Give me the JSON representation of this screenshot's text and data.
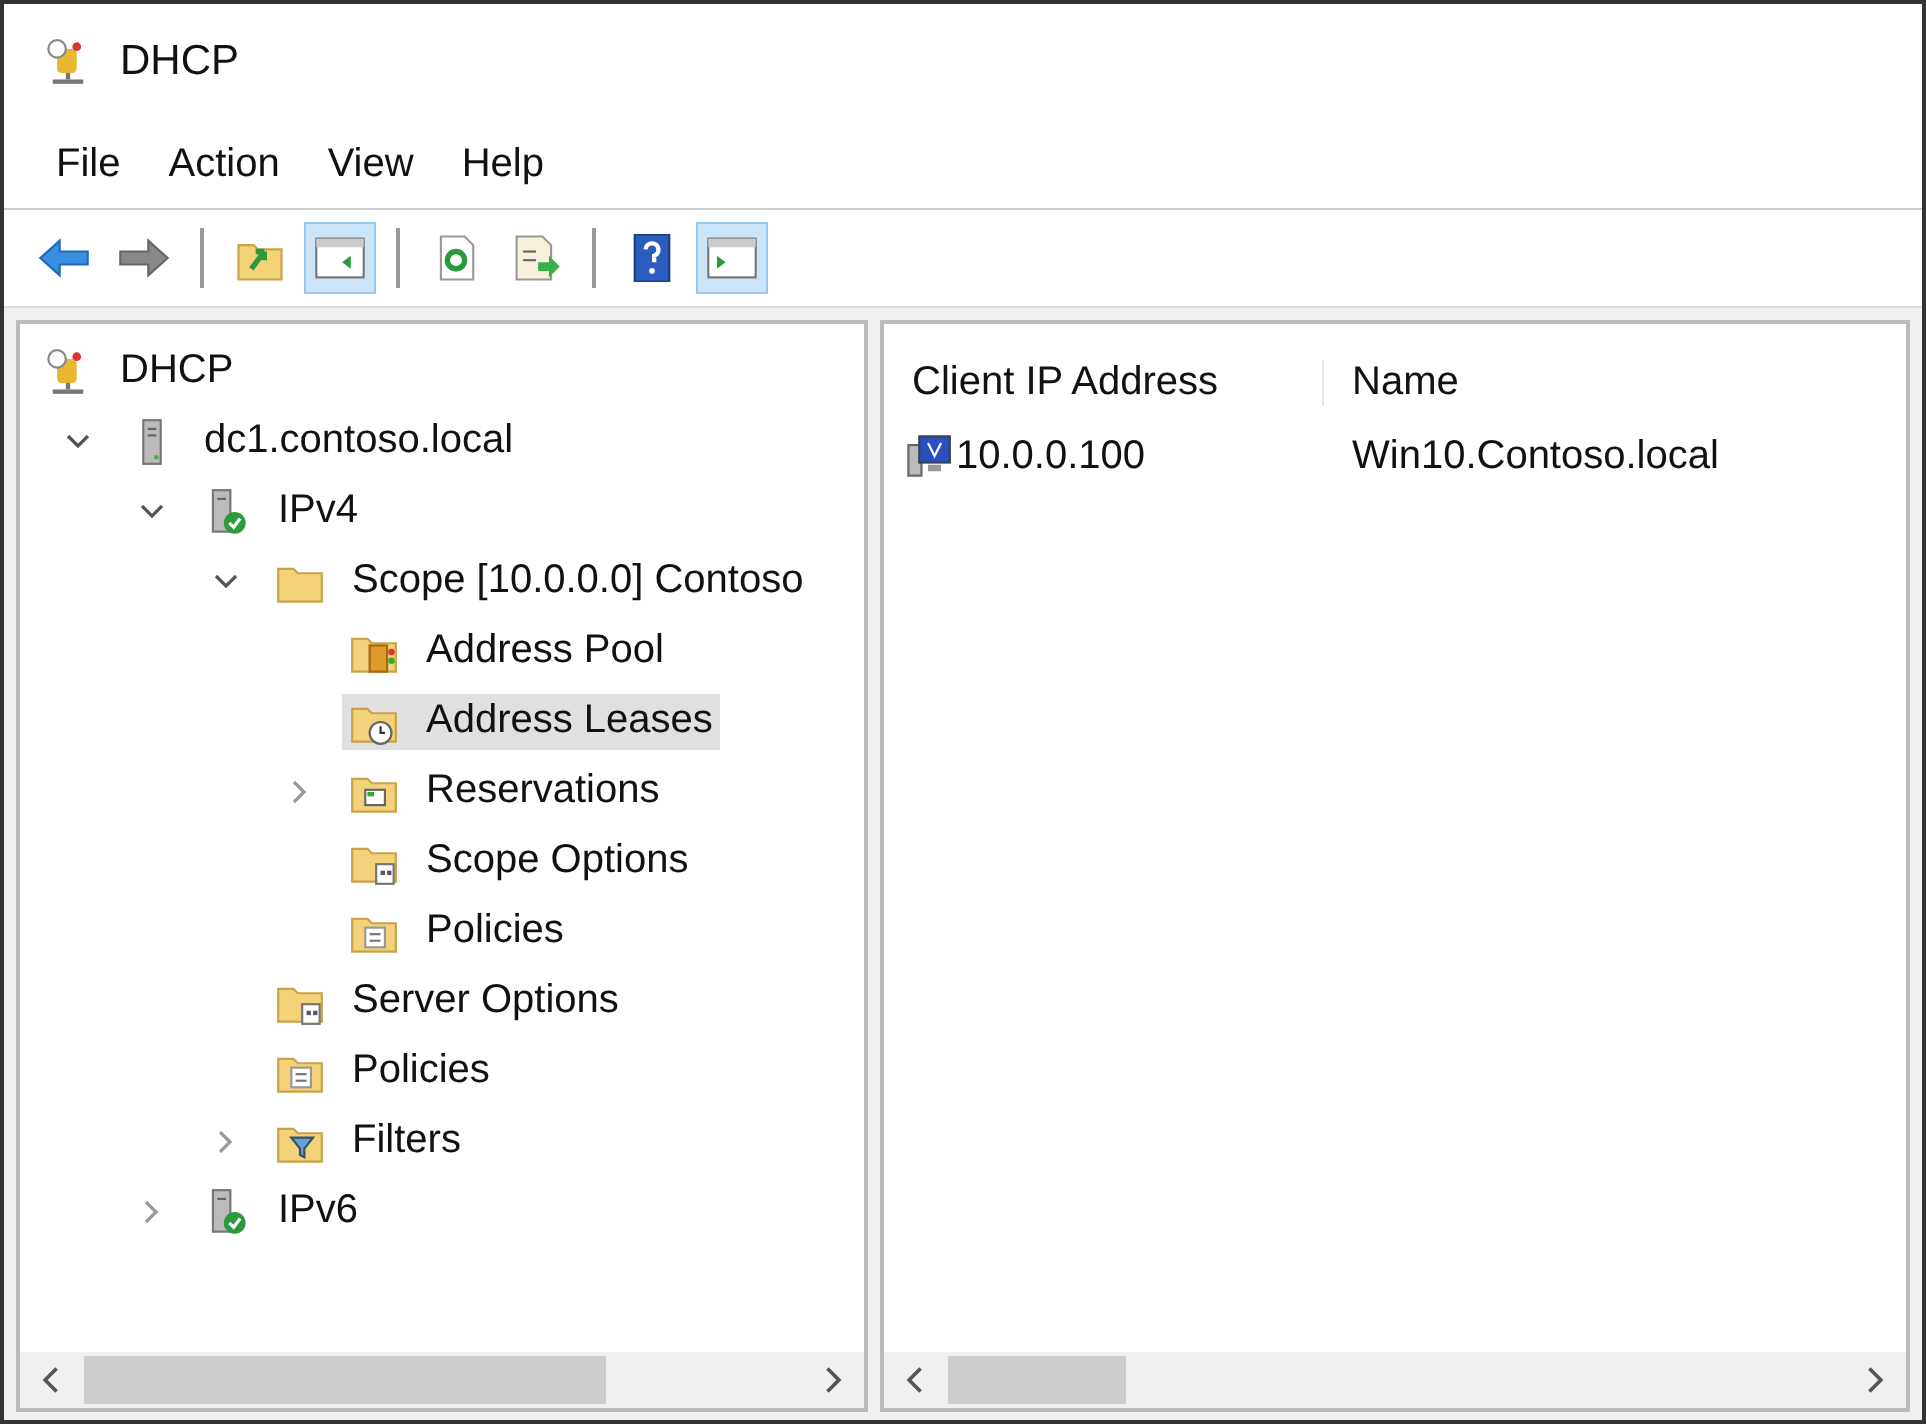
{
  "window": {
    "title": "DHCP"
  },
  "menu": [
    "File",
    "Action",
    "View",
    "Help"
  ],
  "toolbar": [
    {
      "kind": "back",
      "pressed": false
    },
    {
      "kind": "forward",
      "pressed": false
    },
    {
      "kind": "separator"
    },
    {
      "kind": "up",
      "pressed": false
    },
    {
      "kind": "tree-pane",
      "pressed": true
    },
    {
      "kind": "separator"
    },
    {
      "kind": "refresh",
      "pressed": false
    },
    {
      "kind": "export",
      "pressed": false
    },
    {
      "kind": "separator"
    },
    {
      "kind": "help",
      "pressed": false
    },
    {
      "kind": "action-pane",
      "pressed": true
    }
  ],
  "tree": [
    {
      "label": "DHCP",
      "kind": "dhcp",
      "selected": false,
      "children": [
        {
          "label": "dc1.contoso.local",
          "kind": "server",
          "expanded": true,
          "selected": false,
          "children": [
            {
              "label": "IPv4",
              "kind": "protocol",
              "expanded": true,
              "selected": false,
              "children": [
                {
                  "label": "Scope [10.0.0.0] Contoso",
                  "kind": "scope",
                  "expanded": true,
                  "selected": false,
                  "children": [
                    {
                      "label": "Address Pool",
                      "kind": "pool",
                      "selected": false
                    },
                    {
                      "label": "Address Leases",
                      "kind": "leases",
                      "selected": true
                    },
                    {
                      "label": "Reservations",
                      "kind": "reservations",
                      "expanded": false,
                      "selected": false
                    },
                    {
                      "label": "Scope Options",
                      "kind": "options",
                      "selected": false
                    },
                    {
                      "label": "Policies",
                      "kind": "policies",
                      "selected": false
                    }
                  ]
                },
                {
                  "label": "Server Options",
                  "kind": "options",
                  "selected": false
                },
                {
                  "label": "Policies",
                  "kind": "policies",
                  "selected": false
                },
                {
                  "label": "Filters",
                  "kind": "filters",
                  "expanded": false,
                  "selected": false
                }
              ]
            },
            {
              "label": "IPv6",
              "kind": "protocol",
              "expanded": false,
              "selected": false
            }
          ]
        }
      ]
    }
  ],
  "table": {
    "columns": [
      "Client IP Address",
      "Name"
    ],
    "rows": [
      [
        "10.0.0.100",
        "Win10.Contoso.local"
      ]
    ]
  }
}
